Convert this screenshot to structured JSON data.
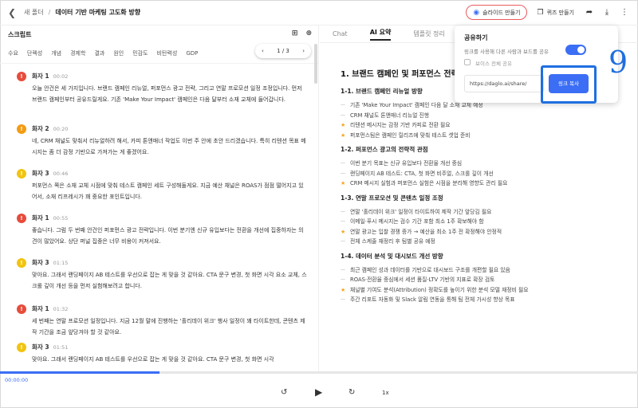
{
  "topbar": {
    "back_icon": "chevron-left-icon",
    "breadcrumb_folder": "새 폴더",
    "breadcrumb_separator": "/",
    "title": "데이터 기반 마케팅 고도화 방향",
    "slide_button": "슬라이드 만들기",
    "quiz_button": "퀴즈 만들기"
  },
  "left": {
    "header": "스크립트",
    "keywords": [
      "수요",
      "단렉성",
      "개념",
      "경제학",
      "결과",
      "원인",
      "민감도",
      "비탄력성",
      "GDP"
    ],
    "pager": "1 / 3",
    "entries": [
      {
        "speaker": "화자 1",
        "time": "00:02",
        "color": "#e74c3c",
        "text": "오늘 안건은 세 가지입니다. 브랜드 캠페인 리뉴얼, 퍼포먼스 광고 전략, 그리고 연말 프로모션 일정 조정입니다. 먼저 브랜드 캠페인부터 공유드릴게요. 기존 'Make Your Impact' 캠페인은 다음 달부터 소재 교체에 들어갑니다."
      },
      {
        "speaker": "화자 2",
        "time": "00:20",
        "color": "#f39c12",
        "text": "네, CRM 채널도 맞춰서 리뉴얼하려 해서, 카피 톤앤매너 작업도 이번 주 안에 초안 드리겠습니다. 특히 리텐션 목표 메시지는 좀 더 감정 기반으로 가져가는 게 좋겠어요."
      },
      {
        "speaker": "화자 3",
        "time": "00:46",
        "color": "#f1c40f",
        "text": "퍼포먼스 쪽은 소재 교체 시점에 맞춰 테스트 캠페인 세트 구성해둘게요. 지금 예산 채널은 ROAS가 점점 떨어지고 있어서, 소재 리프레시가 꽤 중요한 포인트입니다."
      },
      {
        "speaker": "화자 1",
        "time": "00:55",
        "color": "#e74c3c",
        "text": "좋습니다. 그럼 두 번째 안건인 퍼포먼스 광고 전략입니다. 이번 분기엔 신규 유입보다는 전환을 개선에 집중하자는 의견이 많았어요. 상단 퍼널 집중은 너무 비용이 커져서요."
      },
      {
        "speaker": "화자 3",
        "time": "01:15",
        "color": "#f1c40f",
        "text": "맞아요. 그래서 랜딩페이지 AB 테스트를 우선으로 잡는 게 맞을 것 같아요. CTA 문구 변경, 첫 화면 시각 요소 교체, 스크롤 깊이 개선 등을 먼저 실험해보려고 합니다."
      },
      {
        "speaker": "화자 1",
        "time": "01:32",
        "color": "#e74c3c",
        "text": "세 번째는 연말 프로모션 일정입니다. 지금 12월 말에 진행하는 '홀리데이 위크' 행사 일정이 꽤 타이트한데, 콘텐츠 제작 기간을 조금 앞당겨야 할 것 같아요."
      },
      {
        "speaker": "화자 3",
        "time": "01:51",
        "color": "#f1c40f",
        "text": "맞아요. 그래서 랜딩페이지 AB 테스트를 우선으로 잡는 게 맞을 것 같아요. CTA 문구 변경, 첫 화면 시각"
      }
    ]
  },
  "right": {
    "tabs": [
      "Chat",
      "AI 요약",
      "템플릿 정리"
    ],
    "active_tab": "AI 요약",
    "h1": "1. 브랜드 캠페인 및 퍼포먼스 전략",
    "sections": [
      {
        "title": "1-1. 브랜드 캠페인 리뉴얼 방향",
        "items": [
          {
            "star": false,
            "text": "기존 'Make Your Impact' 캠페인 다음 달 소재 교체 예정"
          },
          {
            "star": false,
            "text": "CRM 채널도 톤앤매너 리뉴얼 진행"
          },
          {
            "star": true,
            "text": "리텐션 메시지는 감정 기반 카피로 전환 필요"
          },
          {
            "star": true,
            "text": "퍼포먼스팀은 캠페인 릴리즈에 맞춰 테스트 셋업 준비"
          }
        ]
      },
      {
        "title": "1-2. 퍼포먼스 광고의 전략적 관점",
        "items": [
          {
            "star": false,
            "text": "이번 분기 목표는 신규 유입보다 전환율 개선 중심"
          },
          {
            "star": false,
            "text": "랜딩페이지 AB 테스트: CTA, 첫 화면 비주얼, 스크롤 깊이 개선"
          },
          {
            "star": true,
            "text": "CRM 메시지 실험과 퍼포먼스 실험은 시점을 분리해 영향도 관리 필요"
          }
        ]
      },
      {
        "title": "1-3. 연말 프로모션 및 콘텐츠 일정 조정",
        "items": [
          {
            "star": false,
            "text": "연말 '홀리데이 위크' 일정이 타이트하여 제작 기간 앞당김 필요"
          },
          {
            "star": false,
            "text": "이메일·푸시 메시지는 검수 기간 포함 최소 1주 확보해야 함"
          },
          {
            "star": true,
            "text": "연말 광고는 입찰 경쟁 증가 → 예산을 최소 1주 전 확정해야 안정적"
          },
          {
            "star": false,
            "text": "전체 스케줄 재정리 후 팀별 공유 예정"
          }
        ]
      },
      {
        "title": "1-4. 데이터 분석 및 대시보드 개선 방향",
        "items": [
          {
            "star": false,
            "text": "최근 캠페인 성과 데이터를 기반으로 대시보드 구조를 개편할 필요 있음"
          },
          {
            "star": false,
            "text": "ROAS·전환율 중심에서 세션 품질·LTV 기반의 지표로 확장 검토"
          },
          {
            "star": true,
            "text": "채널별 기여도 분석(Attribution) 정확도를 높이기 위한 분석 모델 재정비 필요"
          },
          {
            "star": false,
            "text": "주간 리포트 자동화 및 Slack 알림 연동을 통해 팀 전체 가시성 향상 목표"
          }
        ]
      }
    ]
  },
  "share_popup": {
    "title": "공유하기",
    "description": "링크를 사용해 다른 사람과 보드를 공유",
    "toggle_on": true,
    "checkbox_label": "보이스 전체 공유",
    "url": "https://daglo.ai/share/",
    "copy_button": "링크 복사",
    "annotation": "9"
  },
  "player": {
    "current_time": "00:00:00",
    "progress": 0.25,
    "speed": "1x"
  },
  "colors": {
    "accent": "#3b6ef5",
    "highlight": "#1f6fe0"
  }
}
